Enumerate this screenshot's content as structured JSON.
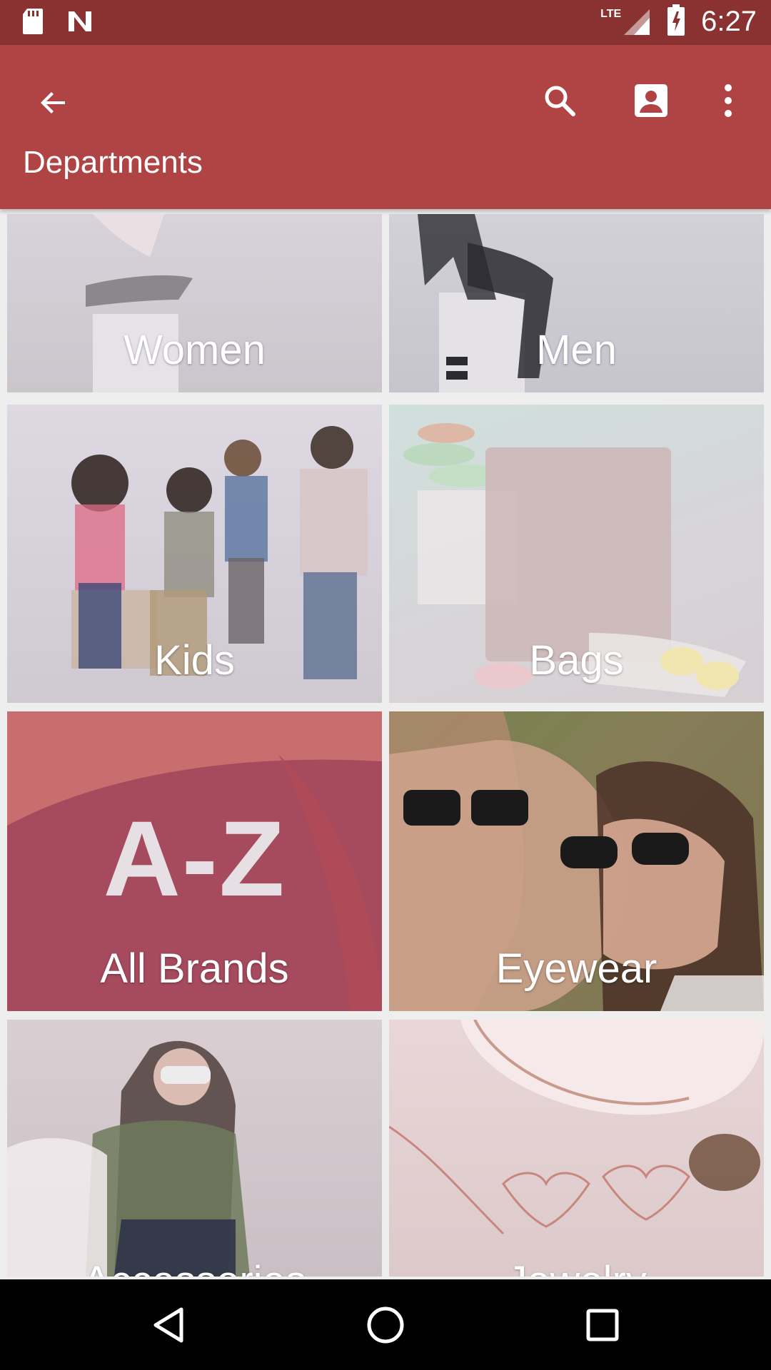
{
  "status_bar": {
    "time": "6:27",
    "network": "LTE",
    "icons": [
      "sd-card-icon",
      "notification-n-icon",
      "signal-icon",
      "battery-charging-icon"
    ]
  },
  "app_bar": {
    "title": "Departments",
    "icons": [
      "back-arrow-icon",
      "search-icon",
      "account-icon",
      "more-vert-icon"
    ],
    "color": "#b04444"
  },
  "departments": {
    "women": "Women",
    "men": "Men",
    "kids": "Kids",
    "bags": "Bags",
    "all_brands": "All Brands",
    "all_brands_badge": "A-Z",
    "eyewear": "Eyewear",
    "accessories": "Accessories",
    "jewelry": "Jewelry"
  },
  "nav_bar": {
    "icons": [
      "back-triangle-icon",
      "home-circle-icon",
      "recents-square-icon"
    ]
  }
}
